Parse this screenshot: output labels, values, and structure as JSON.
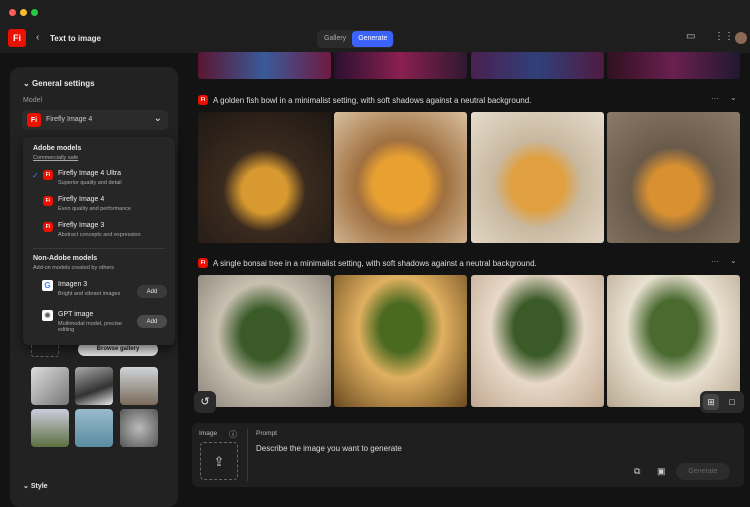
{
  "header": {
    "app_logo": "Fi",
    "back_label": "Text to image",
    "tabs": [
      {
        "label": "Gallery",
        "active": false
      },
      {
        "label": "Generate",
        "active": true
      }
    ]
  },
  "sidebar": {
    "section_title": "General settings",
    "model_label": "Model",
    "selected_model": "Firefly Image 4",
    "browse_gallery": "Browse gallery",
    "style_section": "Style"
  },
  "dropdown": {
    "adobe_title": "Adobe models",
    "adobe_sub": "Commercially safe",
    "adobe_items": [
      {
        "name": "Firefly Image 4 Ultra",
        "desc": "Superior quality and detail",
        "checked": true
      },
      {
        "name": "Firefly Image 4",
        "desc": "Even quality and performance",
        "checked": false
      },
      {
        "name": "Firefly Image 3",
        "desc": "Abstract concepts and expression",
        "checked": false
      }
    ],
    "non_adobe_title": "Non-Adobe models",
    "non_adobe_sub": "Add-on models created by others",
    "non_adobe_items": [
      {
        "name": "Imagen 3",
        "desc": "Bright and vibrant images",
        "action": "Add"
      },
      {
        "name": "GPT image",
        "desc": "Multimodal model, precise editing",
        "action": "Add"
      }
    ]
  },
  "results": [
    {
      "prompt": "A golden fish bowl in a minimalist setting, with soft shadows against a neutral background."
    },
    {
      "prompt": "A single bonsai tree in a minimalist setting, with soft shadows against a neutral background."
    }
  ],
  "prompt_bar": {
    "image_label": "Image",
    "prompt_label": "Prompt",
    "placeholder": "Describe the image you want to generate",
    "generate": "Generate"
  },
  "colors": {
    "accent": "#3b63fb",
    "brand": "#eb1000"
  }
}
